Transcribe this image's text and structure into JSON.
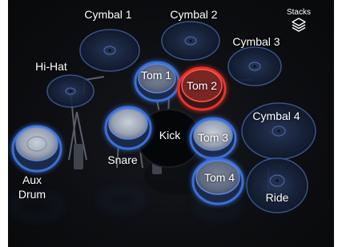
{
  "stacks": {
    "label": "Stacks",
    "icon": "stacks-icon"
  },
  "pads": {
    "cymbal_1": "Cymbal 1",
    "cymbal_2": "Cymbal 2",
    "cymbal_3": "Cymbal 3",
    "cymbal_4": "Cymbal 4",
    "hi_hat": "Hi-Hat",
    "tom_1": "Tom 1",
    "tom_2": "Tom 2",
    "tom_3": "Tom 3",
    "tom_4": "Tom 4",
    "kick": "Kick",
    "snare": "Snare",
    "aux_drum_line1": "Aux",
    "aux_drum_line2": "Drum",
    "ride": "Ride"
  },
  "active_pad": "Tom 2",
  "colors": {
    "pad_glow": "#3a6fd8",
    "active_glow": "#e8302a",
    "background": "#0d0e11"
  }
}
